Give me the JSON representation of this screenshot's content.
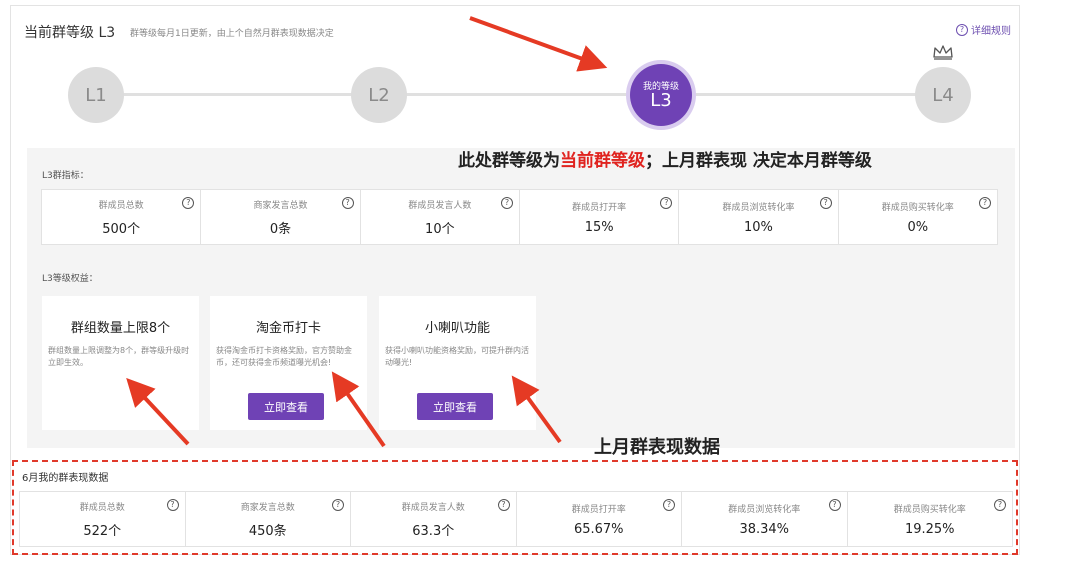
{
  "header": {
    "title": "当前群等级 L3",
    "subtitle": "群等级每月1日更新，由上个自然月群表现数据决定",
    "rule_link": "详细规则"
  },
  "levels": [
    {
      "label": "L1"
    },
    {
      "label": "L2"
    },
    {
      "label": "L3",
      "tag": "我的等级",
      "current": true
    },
    {
      "label": "L4"
    }
  ],
  "annotations": {
    "note_1_prefix": "此处群等级为",
    "note_1_highlight": "当前群等级",
    "note_1_suffix": "；上月群表现 决定本月群等级",
    "note_2": "上月群表现数据"
  },
  "l3_metrics": {
    "section_label": "L3群指标：",
    "items": [
      {
        "label": "群成员总数",
        "value": "500个"
      },
      {
        "label": "商家发言总数",
        "value": "0条"
      },
      {
        "label": "群成员发言人数",
        "value": "10个"
      },
      {
        "label": "群成员打开率",
        "value": "15%"
      },
      {
        "label": "群成员浏览转化率",
        "value": "10%"
      },
      {
        "label": "群成员购买转化率",
        "value": "0%"
      }
    ]
  },
  "benefits": {
    "section_label": "L3等级权益：",
    "cards": [
      {
        "title": "群组数量上限8个",
        "desc": "群组数量上限调整为8个，群等级升级时立即生效。"
      },
      {
        "title": "淘金币打卡",
        "desc": "获得淘金币打卡资格奖励，官方赞助金币，还可获得金币频道曝光机会!",
        "button": "立即查看"
      },
      {
        "title": "小喇叭功能",
        "desc": "获得小喇叭功能资格奖励，可提升群内活动曝光!",
        "button": "立即查看"
      }
    ]
  },
  "june_metrics": {
    "section_label": "6月我的群表现数据",
    "items": [
      {
        "label": "群成员总数",
        "value": "522个"
      },
      {
        "label": "商家发言总数",
        "value": "450条"
      },
      {
        "label": "群成员发言人数",
        "value": "63.3个"
      },
      {
        "label": "群成员打开率",
        "value": "65.67%"
      },
      {
        "label": "群成员浏览转化率",
        "value": "38.34%"
      },
      {
        "label": "群成员购买转化率",
        "value": "19.25%"
      }
    ]
  },
  "colors": {
    "accent": "#6f42b5",
    "annotation_red": "#e0231f"
  },
  "icons": [
    "help-circle-icon",
    "crown-icon",
    "red-arrow-icon"
  ]
}
